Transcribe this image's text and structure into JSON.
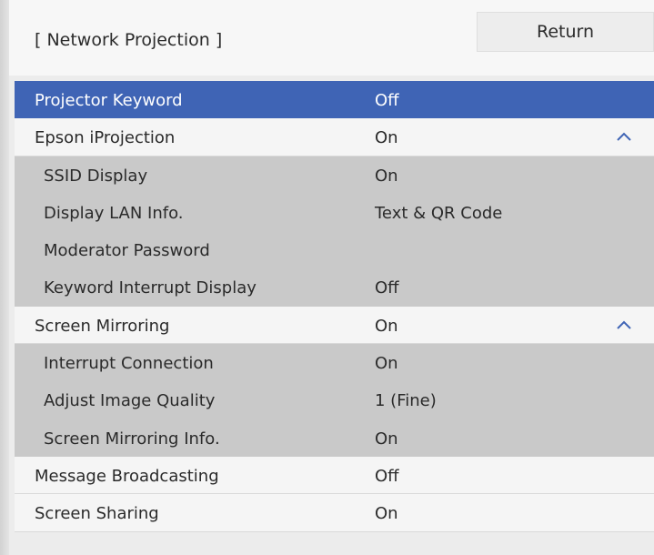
{
  "header": {
    "title": "[ Network Projection ]",
    "return_label": "Return"
  },
  "menu": {
    "items": [
      {
        "label": "Projector Keyword",
        "value": "Off",
        "level": "top",
        "selected": true,
        "expandable": false
      },
      {
        "label": "Epson iProjection",
        "value": "On",
        "level": "top",
        "selected": false,
        "expandable": true,
        "caret_icon": "chevron-up-icon"
      },
      {
        "label": "SSID Display",
        "value": "On",
        "level": "sub",
        "selected": false,
        "expandable": false
      },
      {
        "label": "Display LAN Info.",
        "value": "Text & QR Code",
        "level": "sub",
        "selected": false,
        "expandable": false
      },
      {
        "label": "Moderator Password",
        "value": "",
        "level": "sub",
        "selected": false,
        "expandable": false
      },
      {
        "label": "Keyword Interrupt Display",
        "value": "Off",
        "level": "sub",
        "selected": false,
        "expandable": false
      },
      {
        "label": "Screen Mirroring",
        "value": "On",
        "level": "top",
        "selected": false,
        "expandable": true,
        "caret_icon": "chevron-up-icon"
      },
      {
        "label": "Interrupt Connection",
        "value": "On",
        "level": "sub",
        "selected": false,
        "expandable": false
      },
      {
        "label": "Adjust Image Quality",
        "value": "1 (Fine)",
        "level": "sub",
        "selected": false,
        "expandable": false
      },
      {
        "label": "Screen Mirroring Info.",
        "value": "On",
        "level": "sub",
        "selected": false,
        "expandable": false
      },
      {
        "label": "Message Broadcasting",
        "value": "Off",
        "level": "top",
        "selected": false,
        "expandable": false
      },
      {
        "label": "Screen Sharing",
        "value": "On",
        "level": "top",
        "selected": false,
        "expandable": false
      }
    ]
  },
  "colors": {
    "selected_row": "#3f64b5",
    "sub_row": "#c9c9c9",
    "top_row": "#f5f5f5",
    "caret": "#3f64b5"
  }
}
